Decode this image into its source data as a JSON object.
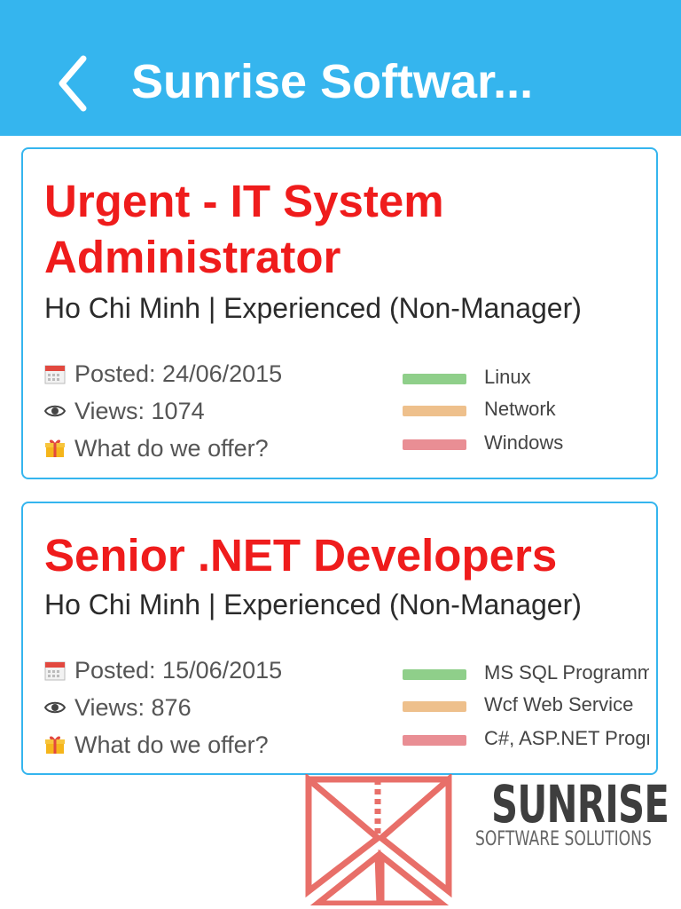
{
  "header": {
    "title": "Sunrise Softwar...",
    "back_icon": "chevron-left-icon"
  },
  "jobs": [
    {
      "title": "Urgent - IT System Administrator",
      "location_level": "Ho Chi Minh | Experienced (Non-Manager)",
      "posted": "Posted: 24/06/2015",
      "views": "Views: 1074",
      "offer": "What do we offer?",
      "tags": [
        {
          "label": "Linux",
          "color": "#8fcf8a"
        },
        {
          "label": "Network",
          "color": "#eec08c"
        },
        {
          "label": "Windows",
          "color": "#e98e94"
        }
      ]
    },
    {
      "title": "Senior .NET Developers",
      "location_level": "Ho Chi Minh | Experienced (Non-Manager)",
      "posted": "Posted: 15/06/2015",
      "views": "Views: 876",
      "offer": "What do we offer?",
      "tags": [
        {
          "label": "MS SQL Programming",
          "color": "#8fcf8a"
        },
        {
          "label": "Wcf Web Service",
          "color": "#eec08c"
        },
        {
          "label": "C#, ASP.NET Programming",
          "color": "#e98e94"
        }
      ]
    }
  ],
  "watermark": {
    "name": "SUNRISE",
    "tagline": "SOFTWARE SOLUTIONS"
  },
  "colors": {
    "header": "#35b5ee",
    "job_title": "#ef1c1c",
    "card_border": "#35b5ee"
  }
}
